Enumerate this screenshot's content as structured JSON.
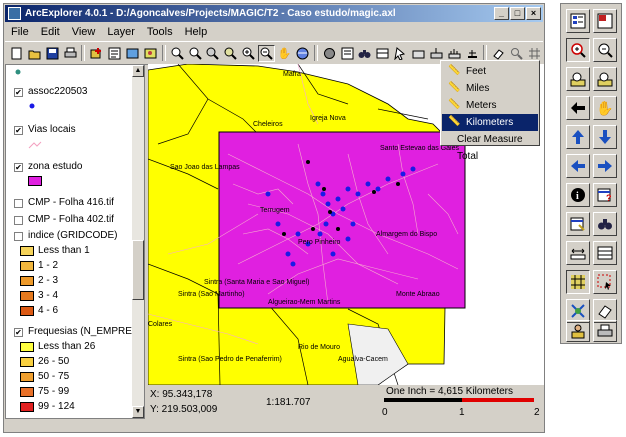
{
  "window": {
    "title": "ArcExplorer 4.0.1 - D:/Agoncalves/Projects/MAGIC/T2 - Caso estudo/magic.axl",
    "minimize": "_",
    "maximize": "□",
    "close": "×"
  },
  "menu": [
    "File",
    "Edit",
    "View",
    "Layer",
    "Tools",
    "Help"
  ],
  "toolbar_icons": [
    "new-map-icon",
    "open-icon",
    "save-icon",
    "print-icon",
    "add-layer-icon",
    "properties-icon",
    "export-icon",
    "image-icon",
    "zoom-in-icon",
    "zoom-out-icon",
    "zoom-layer-icon",
    "full-extent-icon",
    "zoom-box-in-icon",
    "zoom-box-out-icon",
    "pan-icon",
    "globe-icon",
    "identify-icon",
    "find-icon",
    "binoculars-icon",
    "query-icon",
    "hotlink-icon",
    "select-icon",
    "clear-icon",
    "measure-icon",
    "measure-drop-icon",
    "eraser-icon",
    "magnify-icon",
    "grid-icon"
  ],
  "legend": {
    "layers": [
      {
        "label": "assoc220503",
        "checked": true
      },
      {
        "label": "Vias locais",
        "checked": true
      },
      {
        "label": "zona estudo",
        "checked": true
      },
      {
        "label": "CMP - Folha 416.tif",
        "checked": false
      },
      {
        "label": "CMP - Folha 402.tif",
        "checked": false
      },
      {
        "label": "indice (GRIDCODE)",
        "checked": false
      },
      {
        "label": "Frequesias (N_EMPRE",
        "checked": true
      }
    ],
    "indice_classes": [
      {
        "label": "Less than 1",
        "color": "#f5d35a"
      },
      {
        "label": "1 - 2",
        "color": "#f2b73e"
      },
      {
        "label": "2 - 3",
        "color": "#ee9a2a"
      },
      {
        "label": "3 - 4",
        "color": "#e67a1e"
      },
      {
        "label": "4 - 6",
        "color": "#dc5a14"
      }
    ],
    "freq_classes": [
      {
        "label": "Less than 26",
        "color": "#ffff40"
      },
      {
        "label": "26 - 50",
        "color": "#f8d040"
      },
      {
        "label": "50 - 75",
        "color": "#f0a030"
      },
      {
        "label": "75 - 99",
        "color": "#e87028"
      },
      {
        "label": "99 - 124",
        "color": "#e02020"
      }
    ],
    "zona_color": "#e020e0",
    "assoc_color": "#1a1ae6",
    "top_dot_color": "#2f8f7f"
  },
  "map": {
    "place_labels": [
      "Mafra",
      "Igreja Nova",
      "Cheleiros",
      "Santo Estevao das Gales",
      "Sao Joao das Lampas",
      "Terrugem",
      "Pero Pinheiro",
      "Almargem do Bispo",
      "Sintra (Santa Maria e Sao Miguel)",
      "Sintra (Sao Martinho)",
      "Algueirao-Mem Martins",
      "Colares",
      "Rio de Mouro",
      "Agualva-Cacem",
      "Monte Abraao",
      "Sintra (Sao Pedro de Penaferrim)"
    ]
  },
  "status": {
    "x_coord": "X: 95.343,178",
    "y_coord": "Y: 219.503,009",
    "scale": "1:181.707",
    "one_inch": "One Inch = 4,615 Kilometers",
    "bar_ticks": [
      "0",
      "1",
      "2"
    ]
  },
  "measure_menu": {
    "items": [
      {
        "label": "Feet",
        "selected": false
      },
      {
        "label": "Miles",
        "selected": false
      },
      {
        "label": "Meters",
        "selected": false
      },
      {
        "label": "Kilometers",
        "selected": true
      },
      {
        "label": "Clear Measure Total",
        "selected": false
      }
    ]
  },
  "palette_icons": [
    "legend-icon",
    "overview-icon",
    "zoom-in-icon",
    "zoom-out-icon",
    "zoom-box-in-icon",
    "zoom-box-out-icon",
    "back-arrow-icon",
    "pan-hand-icon",
    "arrow-up-icon",
    "arrow-down-icon",
    "arrow-left-icon",
    "arrow-right-icon",
    "identify-icon",
    "query-icon",
    "select-icon",
    "find-icon",
    "measure-icon",
    "buffer-icon",
    "grid-icon",
    "select-box-icon",
    "analysis-icon",
    "eraser-icon",
    "hotlink-icon",
    "print-icon"
  ]
}
